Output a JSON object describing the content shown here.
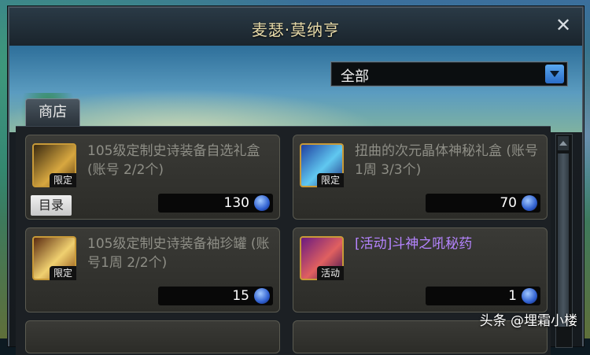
{
  "window": {
    "title": "麦瑟·莫纳亨"
  },
  "filter": {
    "selected": "全部"
  },
  "tab": {
    "label": "商店"
  },
  "items": [
    {
      "name": "105级定制史诗装备自选礼盒 (账号 2/2个)",
      "badge": "限定",
      "price": "130",
      "catalog_label": "目录"
    },
    {
      "name": "扭曲的次元晶体神秘礼盒 (账号1周 3/3个)",
      "badge": "限定",
      "price": "70"
    },
    {
      "name": "105级定制史诗装备袖珍罐 (账号1周 2/2个)",
      "badge": "限定",
      "price": "15"
    },
    {
      "name": "[活动]斗神之吼秘药",
      "badge": "活动",
      "price": "1"
    }
  ],
  "watermark": "头条 @埋霜小楼",
  "colors": {
    "title": "#e6d9a8",
    "event_item": "#b584ff",
    "dim_item": "#8e8e86"
  }
}
